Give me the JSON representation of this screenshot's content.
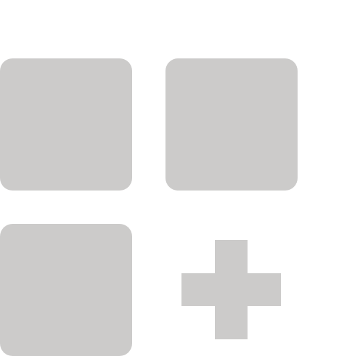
{
  "icon": {
    "name": "apps-grid-add-icon",
    "color": "#cccbca",
    "tiles": [
      {
        "name": "app-tile-1"
      },
      {
        "name": "app-tile-2"
      },
      {
        "name": "app-tile-3"
      }
    ],
    "add": {
      "name": "plus-icon"
    }
  }
}
